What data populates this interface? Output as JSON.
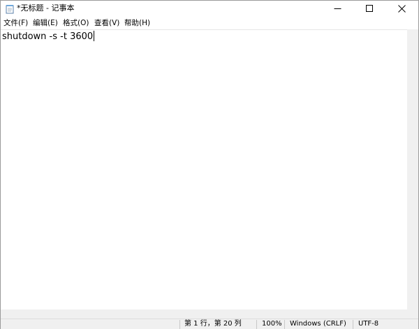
{
  "window": {
    "title": "*无标题 - 记事本",
    "icons": {
      "app": "notepad-icon",
      "minimize": "minimize-icon",
      "maximize": "maximize-icon",
      "close": "close-icon"
    }
  },
  "menubar": {
    "items": [
      {
        "label": "文件(F)"
      },
      {
        "label": "编辑(E)"
      },
      {
        "label": "格式(O)"
      },
      {
        "label": "查看(V)"
      },
      {
        "label": "帮助(H)"
      }
    ]
  },
  "editor": {
    "text": "shutdown -s -t 3600"
  },
  "statusbar": {
    "position": "第 1 行，第 20 列",
    "zoom": "100%",
    "line_ending": "Windows (CRLF)",
    "encoding": "UTF-8"
  },
  "colors": {
    "chrome": "#f0f0f0",
    "background": "#ffffff"
  }
}
